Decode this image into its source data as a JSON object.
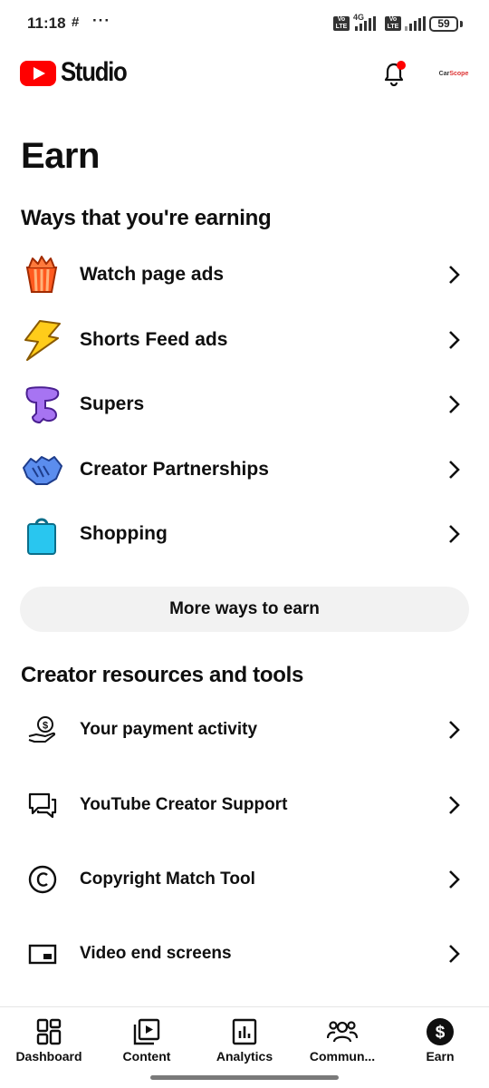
{
  "status_bar": {
    "time": "11:18",
    "notif_glyph": "#",
    "more": "···",
    "network": "4G",
    "volte_label": "Vo LTE",
    "battery": "59"
  },
  "header": {
    "app_name": "Studio",
    "avatar_text_a": "Car",
    "avatar_text_b": "Scope",
    "accent": "#ff0000"
  },
  "page": {
    "title": "Earn"
  },
  "earning": {
    "heading": "Ways that you're earning",
    "items": [
      {
        "label": "Watch page ads",
        "icon": "popcorn-icon"
      },
      {
        "label": "Shorts Feed ads",
        "icon": "lightning-icon"
      },
      {
        "label": "Supers",
        "icon": "supers-icon"
      },
      {
        "label": "Creator Partnerships",
        "icon": "handshake-icon"
      },
      {
        "label": "Shopping",
        "icon": "shopping-bag-icon"
      }
    ],
    "more_button": "More ways to earn"
  },
  "resources": {
    "heading": "Creator resources and tools",
    "items": [
      {
        "label": "Your payment activity",
        "icon": "payment-hand-icon"
      },
      {
        "label": "YouTube Creator Support",
        "icon": "support-chat-icon"
      },
      {
        "label": "Copyright Match Tool",
        "icon": "copyright-icon"
      },
      {
        "label": "Video end screens",
        "icon": "end-screen-icon"
      }
    ]
  },
  "bottom_nav": {
    "items": [
      {
        "label": "Dashboard",
        "icon": "dashboard-icon"
      },
      {
        "label": "Content",
        "icon": "content-icon"
      },
      {
        "label": "Analytics",
        "icon": "analytics-icon"
      },
      {
        "label": "Commun...",
        "icon": "community-icon"
      },
      {
        "label": "Earn",
        "icon": "earn-dollar-icon"
      }
    ],
    "active": "Earn"
  }
}
